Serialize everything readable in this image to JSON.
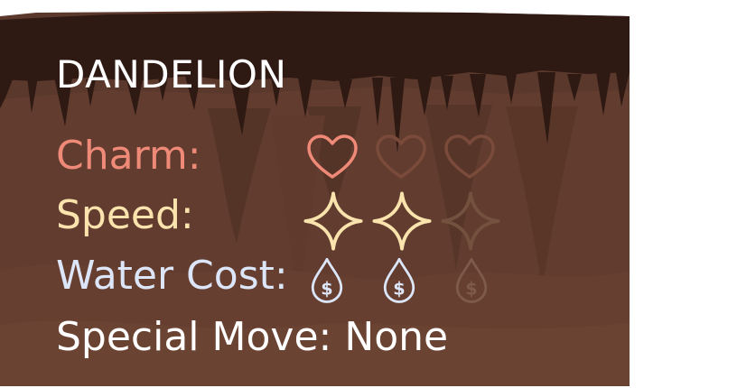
{
  "plant": {
    "name": "DANDELION",
    "special_move": "Special Move: None"
  },
  "stats": [
    {
      "key": "charm",
      "label": "Charm:",
      "value": 1,
      "max": 3,
      "icon": "heart-icon",
      "color": "#f08a78",
      "dim_color": "#7a4b3a"
    },
    {
      "key": "speed",
      "label": "Speed:",
      "value": 2,
      "max": 3,
      "icon": "sparkle-icon",
      "color": "#fbe3ad",
      "dim_color": "#74503e"
    },
    {
      "key": "water",
      "label": "Water Cost:",
      "value": 2,
      "max": 3,
      "icon": "water-drop-dollar-icon",
      "color": "#dde6f8",
      "dim_color": "#7e5a4a"
    }
  ],
  "colors": {
    "panel_bg": "#5b382c",
    "cave_shadow": "#2e1913",
    "mid_layer": "#663f30"
  }
}
